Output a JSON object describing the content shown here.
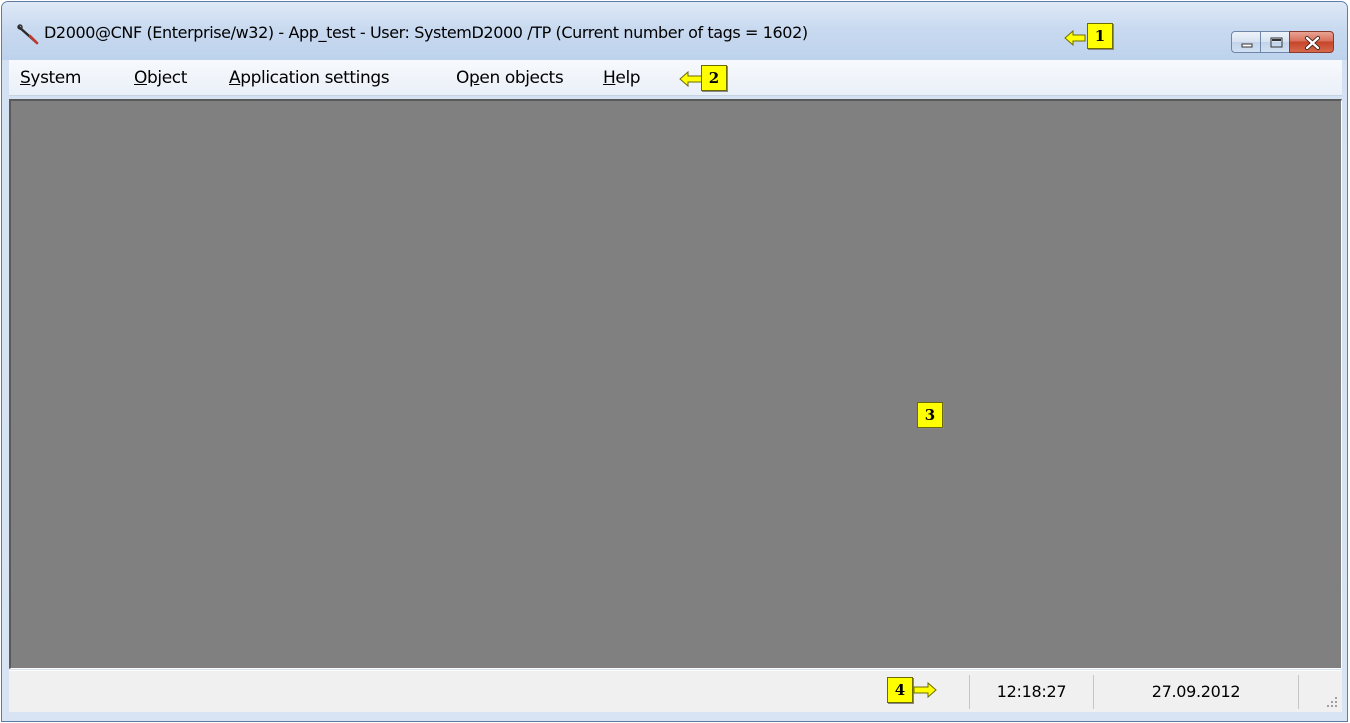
{
  "window": {
    "title": "D2000@CNF (Enterprise/w32) - App_test -  User: SystemD2000 /TP  (Current number of tags =  1602)",
    "icon": "wrench-icon",
    "controls": [
      "minimize-icon",
      "maximize-icon",
      "close-icon"
    ]
  },
  "menubar": {
    "items": [
      {
        "label": "System",
        "accel": "S"
      },
      {
        "label": "Object",
        "accel": "O"
      },
      {
        "label": "Application settings",
        "accel": "A"
      },
      {
        "label": "Open objects",
        "accel": "p"
      },
      {
        "label": "Help",
        "accel": "H"
      }
    ]
  },
  "callouts": [
    "1",
    "2",
    "3",
    "4"
  ],
  "statusbar": {
    "time": "12:18:27",
    "date": "27.09.2012"
  },
  "colors": {
    "workspace": "#808080",
    "callout": "#ffff00",
    "statusbar": "#f0f0f0"
  }
}
